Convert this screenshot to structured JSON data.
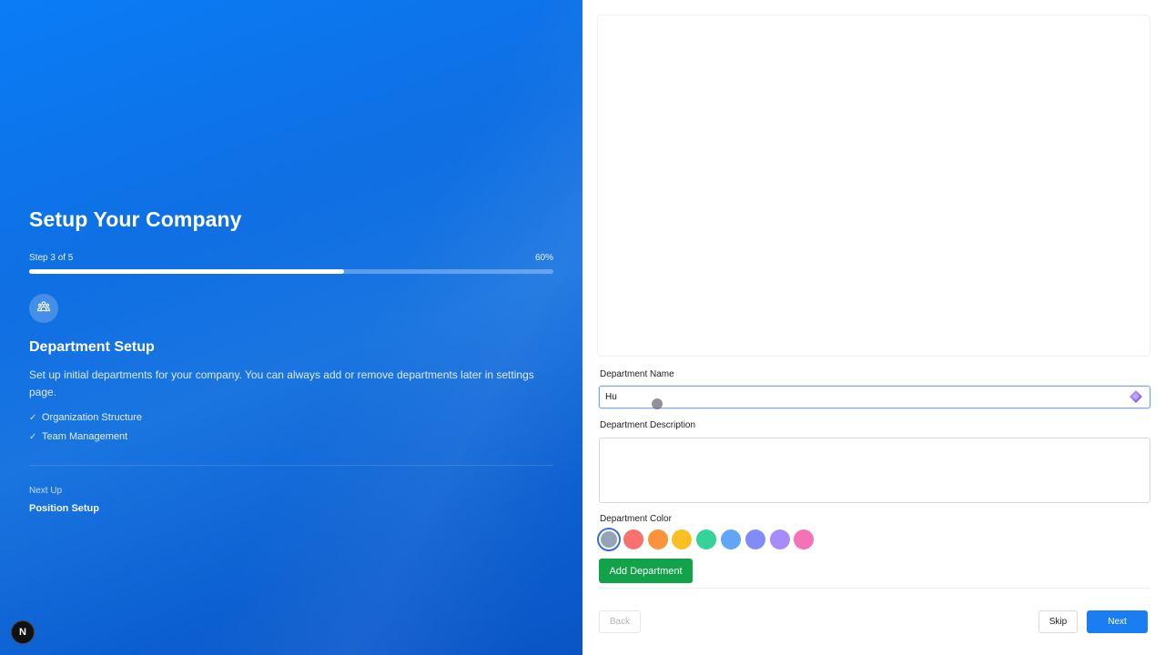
{
  "left": {
    "title": "Setup Your Company",
    "step_label": "Step 3 of 5",
    "progress_label": "60%",
    "progress_fraction": 0.6,
    "section_icon": "team-people-icon",
    "section_title": "Department Setup",
    "section_description": "Set up initial departments for your company. You can always add or remove departments later in settings page.",
    "checklist": [
      {
        "icon": "check-icon",
        "label": "Organization Structure"
      },
      {
        "icon": "check-icon",
        "label": "Team Management"
      }
    ],
    "next_up_label": "Next Up",
    "next_up_value": "Position Setup",
    "logo_letter": "N"
  },
  "form": {
    "name_label": "Department Name",
    "name_value": "Hu",
    "name_icon": "ai-sparkle-icon",
    "description_label": "Department Description",
    "description_value": "",
    "color_label": "Department Color",
    "colors": [
      "#94a3b8",
      "#f87171",
      "#fb923c",
      "#fbbf24",
      "#34d399",
      "#60a5fa",
      "#818cf8",
      "#a78bfa",
      "#f472b6"
    ],
    "selected_color": "#94a3b8",
    "add_button": "Add Department"
  },
  "footer": {
    "back": "Back",
    "skip": "Skip",
    "next": "Next"
  },
  "colors": {
    "brand_blue": "#1a7ef2",
    "add_green": "#12a34a"
  }
}
